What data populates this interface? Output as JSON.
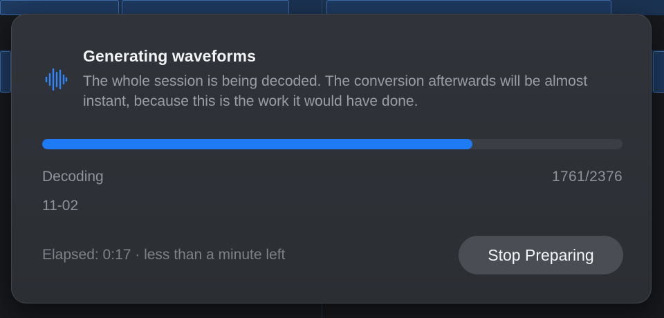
{
  "dialog": {
    "icon": "waveform-icon",
    "title": "Generating waveforms",
    "description": "The whole session is being decoded. The conversion afterwards will be almost instant, because this is the work it would have done.",
    "progress": {
      "fraction": 0.7412,
      "accent_color": "#1f7af6"
    },
    "status_label": "Decoding",
    "status_count": "1761/2376",
    "current_item": "11-02",
    "elapsed_text": "Elapsed: 0:17 · less than a minute left",
    "stop_button_label": "Stop Preparing"
  }
}
